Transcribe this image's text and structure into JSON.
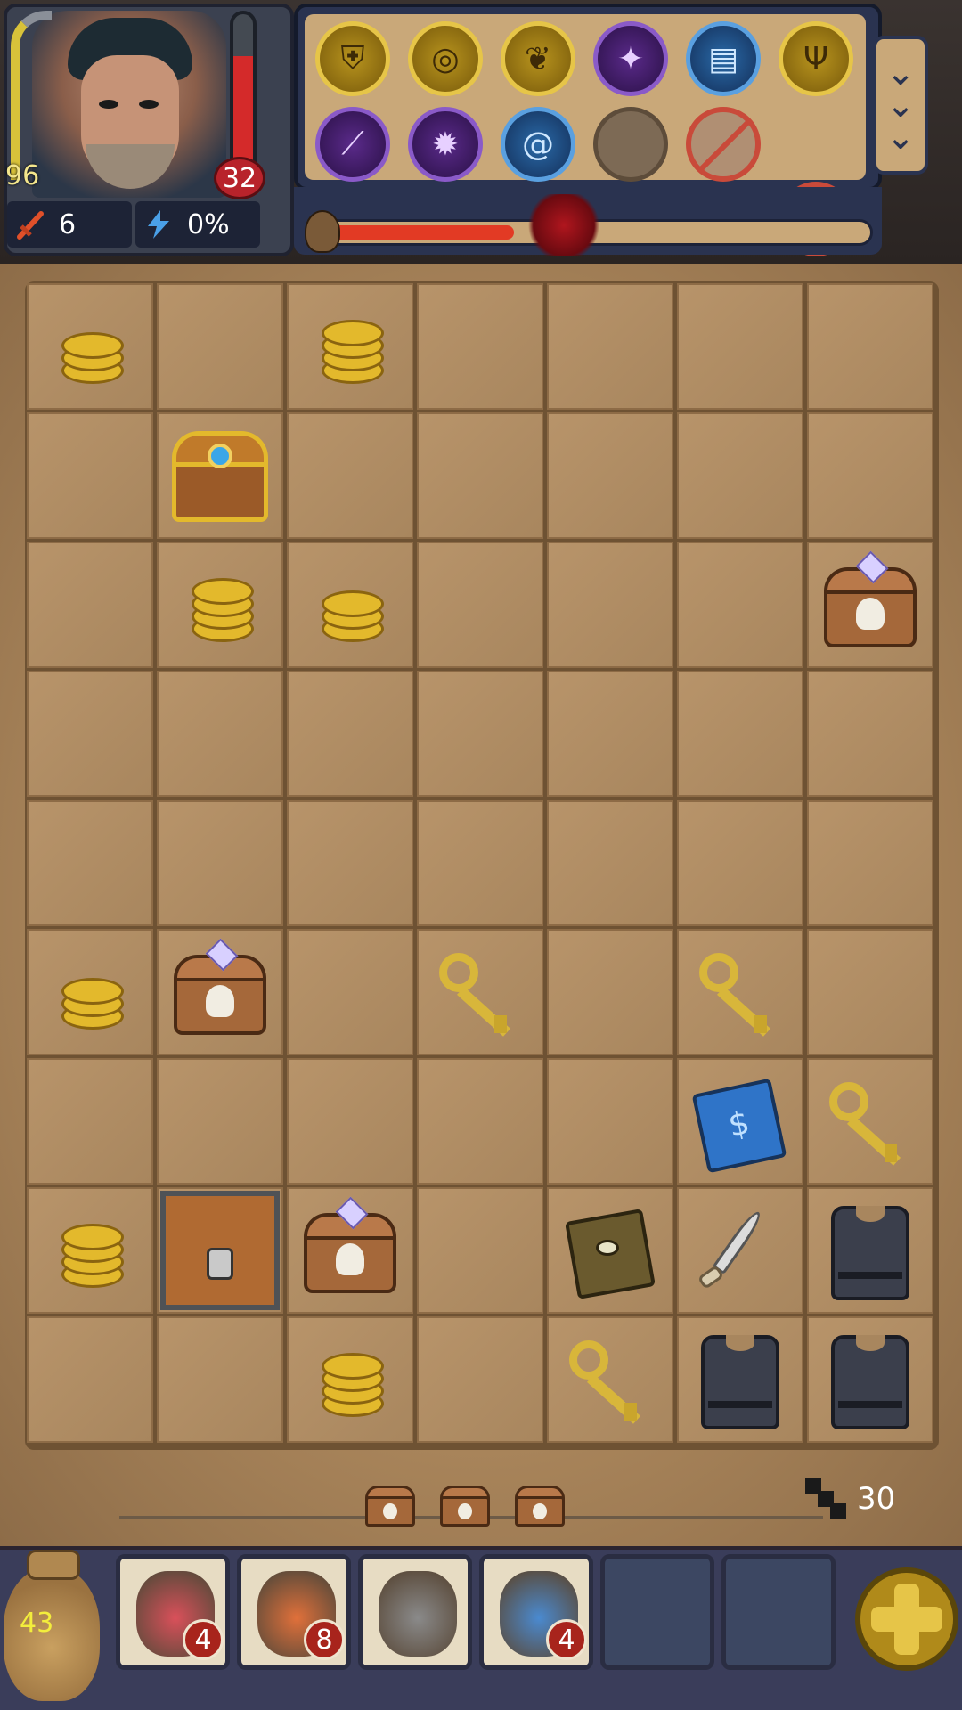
{
  "hero": {
    "level": "96",
    "hp": "32",
    "hp_fraction": 0.75,
    "attack": "6",
    "energy": "0%",
    "portrait_icon": "pirate-portrait"
  },
  "skills": [
    {
      "icon": "armor-skill-icon",
      "style": "gold",
      "glyph": "⛨"
    },
    {
      "icon": "target-skill-icon",
      "style": "gold",
      "glyph": "◎"
    },
    {
      "icon": "wing-skill-icon",
      "style": "gold",
      "glyph": "❦"
    },
    {
      "icon": "winged-sword-skill-icon",
      "style": "purple",
      "glyph": "✦"
    },
    {
      "icon": "book-skill-icon",
      "style": "blue",
      "glyph": "▤"
    },
    {
      "icon": "claw-skill-icon",
      "style": "gold",
      "glyph": "Ψ"
    },
    {
      "icon": "blade-skill-icon",
      "style": "purple",
      "glyph": "⟋"
    },
    {
      "icon": "dark-gear-skill-icon",
      "style": "purple",
      "glyph": "✹"
    },
    {
      "icon": "spiral-skill-icon",
      "style": "blue",
      "glyph": "@"
    },
    {
      "icon": "empty-skill-slot",
      "style": "empty",
      "glyph": ""
    },
    {
      "icon": "locked-skill-slot",
      "style": "locked",
      "glyph": ""
    },
    {
      "icon": "locked-skill-slot",
      "style": "locked",
      "glyph": ""
    }
  ],
  "boss_progress_fraction": 0.35,
  "board": {
    "cols": 7,
    "rows": 9,
    "items": [
      {
        "r": 0,
        "c": 0,
        "type": "coins",
        "n": 3
      },
      {
        "r": 0,
        "c": 2,
        "type": "coins",
        "n": 4
      },
      {
        "r": 1,
        "c": 1,
        "type": "chest-gold"
      },
      {
        "r": 2,
        "c": 1,
        "type": "coins",
        "n": 4
      },
      {
        "r": 2,
        "c": 2,
        "type": "coins",
        "n": 3
      },
      {
        "r": 2,
        "c": 6,
        "type": "chest-skull"
      },
      {
        "r": 5,
        "c": 0,
        "type": "coins",
        "n": 3
      },
      {
        "r": 5,
        "c": 1,
        "type": "chest-skull"
      },
      {
        "r": 5,
        "c": 3,
        "type": "key"
      },
      {
        "r": 5,
        "c": 5,
        "type": "key"
      },
      {
        "r": 6,
        "c": 5,
        "type": "book-blue"
      },
      {
        "r": 6,
        "c": 6,
        "type": "key"
      },
      {
        "r": 7,
        "c": 0,
        "type": "coins",
        "n": 4
      },
      {
        "r": 7,
        "c": 1,
        "type": "locked-chest"
      },
      {
        "r": 7,
        "c": 2,
        "type": "chest-skull"
      },
      {
        "r": 7,
        "c": 4,
        "type": "book-brown"
      },
      {
        "r": 7,
        "c": 5,
        "type": "dagger"
      },
      {
        "r": 7,
        "c": 6,
        "type": "armor"
      },
      {
        "r": 8,
        "c": 2,
        "type": "coins",
        "n": 4
      },
      {
        "r": 8,
        "c": 4,
        "type": "key"
      },
      {
        "r": 8,
        "c": 5,
        "type": "armor"
      },
      {
        "r": 8,
        "c": 6,
        "type": "armor"
      }
    ]
  },
  "pending_chests": 3,
  "steps": "30",
  "bag_count": "43",
  "inventory": [
    {
      "icon": "health-potion-icon",
      "qty": "4",
      "color": "#d9505a"
    },
    {
      "icon": "fire-bottle-icon",
      "qty": "8",
      "color": "#e0703a"
    },
    {
      "icon": "bomb-icon",
      "qty": "",
      "color": "#8a8a8a"
    },
    {
      "icon": "mana-potion-icon",
      "qty": "4",
      "color": "#4a8ad0"
    },
    {
      "icon": "empty-slot",
      "qty": "",
      "color": ""
    },
    {
      "icon": "empty-slot",
      "qty": "",
      "color": ""
    }
  ],
  "colors": {
    "hp": "#d42a2a",
    "xp": "#d8c23a",
    "progress": "#e23a24",
    "board": "#b8946a"
  }
}
